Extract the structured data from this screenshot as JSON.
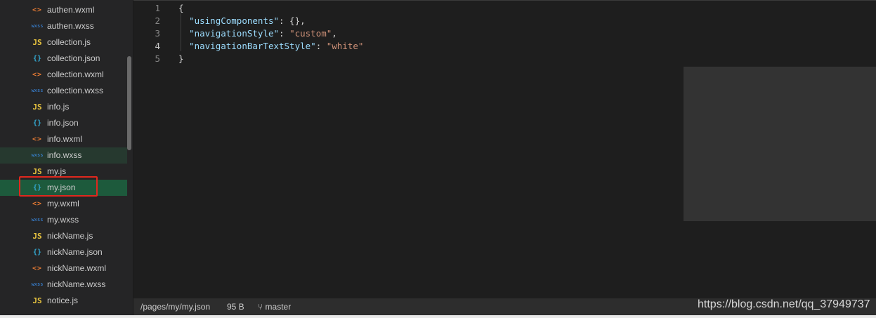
{
  "sidebar": {
    "files": [
      {
        "icon": "<>",
        "type": "wxml",
        "name": "authen.wxml"
      },
      {
        "icon": "wxss",
        "type": "wxss",
        "name": "authen.wxss"
      },
      {
        "icon": "JS",
        "type": "js",
        "name": "collection.js"
      },
      {
        "icon": "{}",
        "type": "json",
        "name": "collection.json"
      },
      {
        "icon": "<>",
        "type": "wxml",
        "name": "collection.wxml"
      },
      {
        "icon": "wxss",
        "type": "wxss",
        "name": "collection.wxss"
      },
      {
        "icon": "JS",
        "type": "js",
        "name": "info.js"
      },
      {
        "icon": "{}",
        "type": "json",
        "name": "info.json"
      },
      {
        "icon": "<>",
        "type": "wxml",
        "name": "info.wxml"
      },
      {
        "icon": "wxss",
        "type": "wxss",
        "name": "info.wxss",
        "state": "hover"
      },
      {
        "icon": "JS",
        "type": "js",
        "name": "my.js"
      },
      {
        "icon": "{}",
        "type": "json",
        "name": "my.json",
        "state": "active"
      },
      {
        "icon": "<>",
        "type": "wxml",
        "name": "my.wxml"
      },
      {
        "icon": "wxss",
        "type": "wxss",
        "name": "my.wxss"
      },
      {
        "icon": "JS",
        "type": "js",
        "name": "nickName.js"
      },
      {
        "icon": "{}",
        "type": "json",
        "name": "nickName.json"
      },
      {
        "icon": "<>",
        "type": "wxml",
        "name": "nickName.wxml"
      },
      {
        "icon": "wxss",
        "type": "wxss",
        "name": "nickName.wxss"
      },
      {
        "icon": "JS",
        "type": "js",
        "name": "notice.js"
      }
    ]
  },
  "editor": {
    "current_line": 4,
    "lines": [
      {
        "n": "1",
        "tokens": [
          [
            "p",
            "{"
          ]
        ]
      },
      {
        "n": "2",
        "tokens": [
          [
            "p",
            "  "
          ],
          [
            "k",
            "\"usingComponents\""
          ],
          [
            "p",
            ": {},"
          ]
        ]
      },
      {
        "n": "3",
        "tokens": [
          [
            "p",
            "  "
          ],
          [
            "k",
            "\"navigationStyle\""
          ],
          [
            "p",
            ": "
          ],
          [
            "s",
            "\"custom\""
          ],
          [
            "p",
            ","
          ]
        ]
      },
      {
        "n": "4",
        "tokens": [
          [
            "p",
            "  "
          ],
          [
            "k",
            "\"navigationBarTextStyle\""
          ],
          [
            "p",
            ": "
          ],
          [
            "s",
            "\"white\""
          ]
        ]
      },
      {
        "n": "5",
        "tokens": [
          [
            "p",
            "}"
          ]
        ]
      }
    ]
  },
  "statusbar": {
    "path": "/pages/my/my.json",
    "size": "95 B",
    "branch_icon": "branch-icon",
    "branch": "master"
  },
  "watermark": "https://blog.csdn.net/qq_37949737",
  "colors": {
    "keyword": "#9cdcfe",
    "string": "#ce9178",
    "active_row": "#1d5a3c",
    "highlight_box": "#e0281e"
  }
}
